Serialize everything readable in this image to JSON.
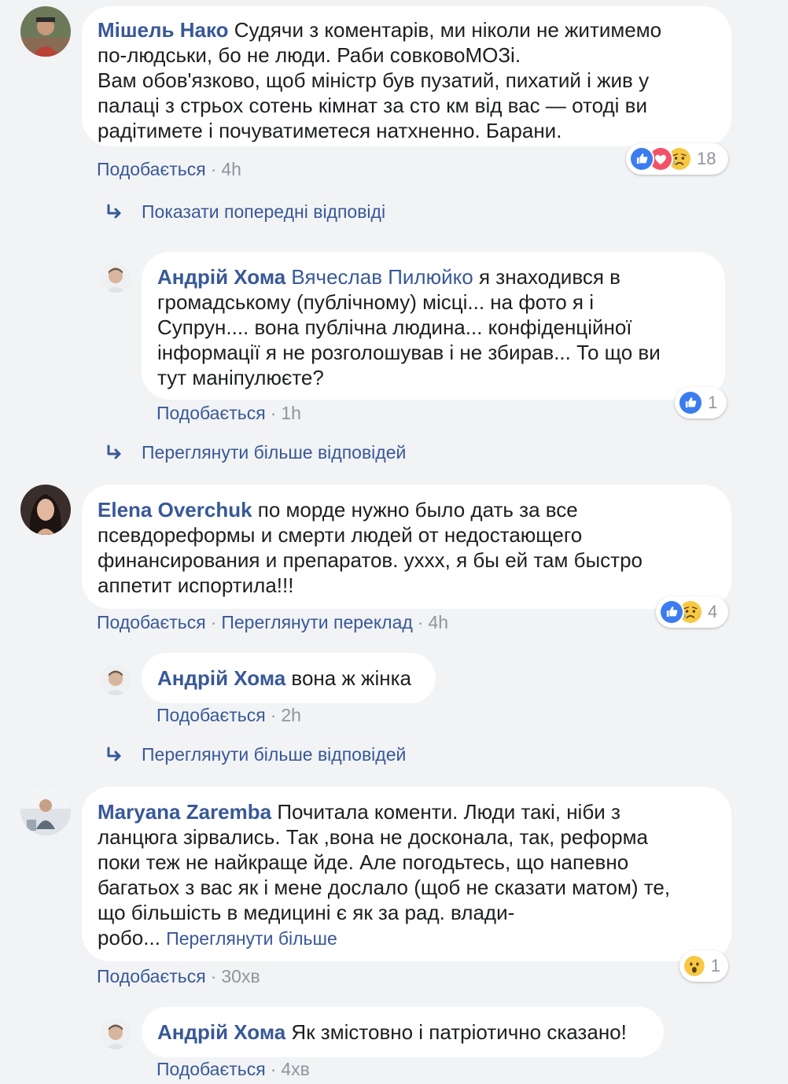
{
  "c1": {
    "author": "Мішель Нако",
    "lines": [
      "Судячи з коментарів, ми ніколи не житимемо",
      "по-людськи, бо не люди. Раби совковоМОЗі.",
      "Вам обов'язково, щоб міністр був пузатий, пихатий і жив у",
      "палаці з стрьох сотень кімнат за сто км від вас — отоді ви",
      "радітимете і почуватиметеся натхненно. Барани."
    ],
    "like": "Подобається",
    "time": "4h",
    "reaction_count": "18"
  },
  "more1": "Показати попередні відповіді",
  "r1": {
    "author": "Андрій Хома",
    "mention": "Вячеслав Пилюйко",
    "lines": [
      "я знаходився в",
      "громадському (публічному) місці... на фото я і",
      "Супрун.... вона публічна людина... конфіденційної",
      "інформації я не розголошував і не збирав... То що ви",
      "тут маніпулюєте?"
    ],
    "like": "Подобається",
    "time": "1h",
    "reaction_count": "1"
  },
  "more2": "Переглянути більше відповідей",
  "c2": {
    "author": "Elena Overchuk",
    "lines": [
      "по морде нужно было дать за все",
      "псевдореформы и смерти людей от недостающего",
      "финансирования и препаратов. уххх, я бы ей там быстро",
      "аппетит испортила!!!"
    ],
    "like": "Подобається",
    "translate": "Переглянути переклад",
    "time": "4h",
    "reaction_count": "4"
  },
  "r2": {
    "author": "Андрій Хома",
    "text": "вона ж жінка",
    "like": "Подобається",
    "time": "2h"
  },
  "more3": "Переглянути більше відповідей",
  "c3": {
    "author": "Maryana Zaremba",
    "lines": [
      "Почитала коменти. Люди такі, ніби з",
      "ланцюга зірвались. Так ,вона не досконала, так, реформа",
      "поки теж не найкраще йде. Але погодьтесь, що напевно",
      "багатьох з вас як і мене дослало (щоб не сказати матом) те,",
      "що більшість в медицині є як за рад. влади-",
      "робо..."
    ],
    "see_more": "Переглянути більше",
    "like": "Подобається",
    "time": "30хв",
    "reaction_count": "1"
  },
  "r3": {
    "author": "Андрій Хома",
    "text": "Як змістовно і патріотично сказано!",
    "like": "Подобається",
    "time": "4хв"
  },
  "colors": {
    "link": "#385898",
    "meta": "#90949c",
    "bubble": "#ffffff",
    "background": "#f2f3f5",
    "like_blue": "#4267b2",
    "love_red": "#f25268",
    "sad_yellow": "#f7c843"
  }
}
